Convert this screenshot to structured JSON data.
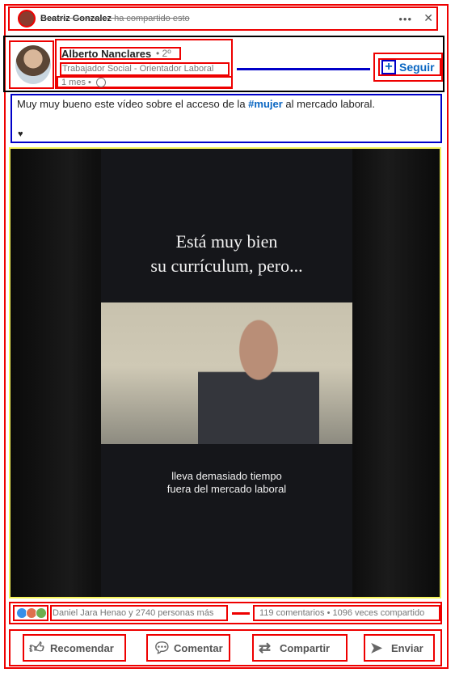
{
  "share": {
    "sharer_name": "Beatriz Gonzalez",
    "shared_text": "ha compartido esto"
  },
  "author": {
    "name": "Alberto Nanclares",
    "degree": "• 2º",
    "headline": "Trabajador Social - Orientador Laboral",
    "time": "1 mes •"
  },
  "follow_label": "Seguir",
  "post": {
    "text_before": "Muy muy bueno este vídeo sobre el acceso de la ",
    "hashtag": "#mujer",
    "text_after": " al mercado laboral.",
    "emoji": "♥"
  },
  "video": {
    "title_line1": "Está muy bien",
    "title_line2": "su currículum, pero...",
    "subtitle_line1": "lleva demasiado tiempo",
    "subtitle_line2": "fuera del mercado laboral"
  },
  "reactions": {
    "summary": "Daniel Jara Henao y 2740 personas más",
    "stats": "119 comentarios • 1096 veces compartido"
  },
  "actions": [
    {
      "label": "Recomendar",
      "icon": "thumb-up-icon"
    },
    {
      "label": "Comentar",
      "icon": "comment-icon"
    },
    {
      "label": "Compartir",
      "icon": "share-icon"
    },
    {
      "label": "Enviar",
      "icon": "send-icon"
    }
  ],
  "colors": {
    "link_blue": "#0a66c2",
    "annotation_red": "#e00000",
    "annotation_blue": "#0000c8",
    "annotation_yellow": "#f5f35a"
  }
}
